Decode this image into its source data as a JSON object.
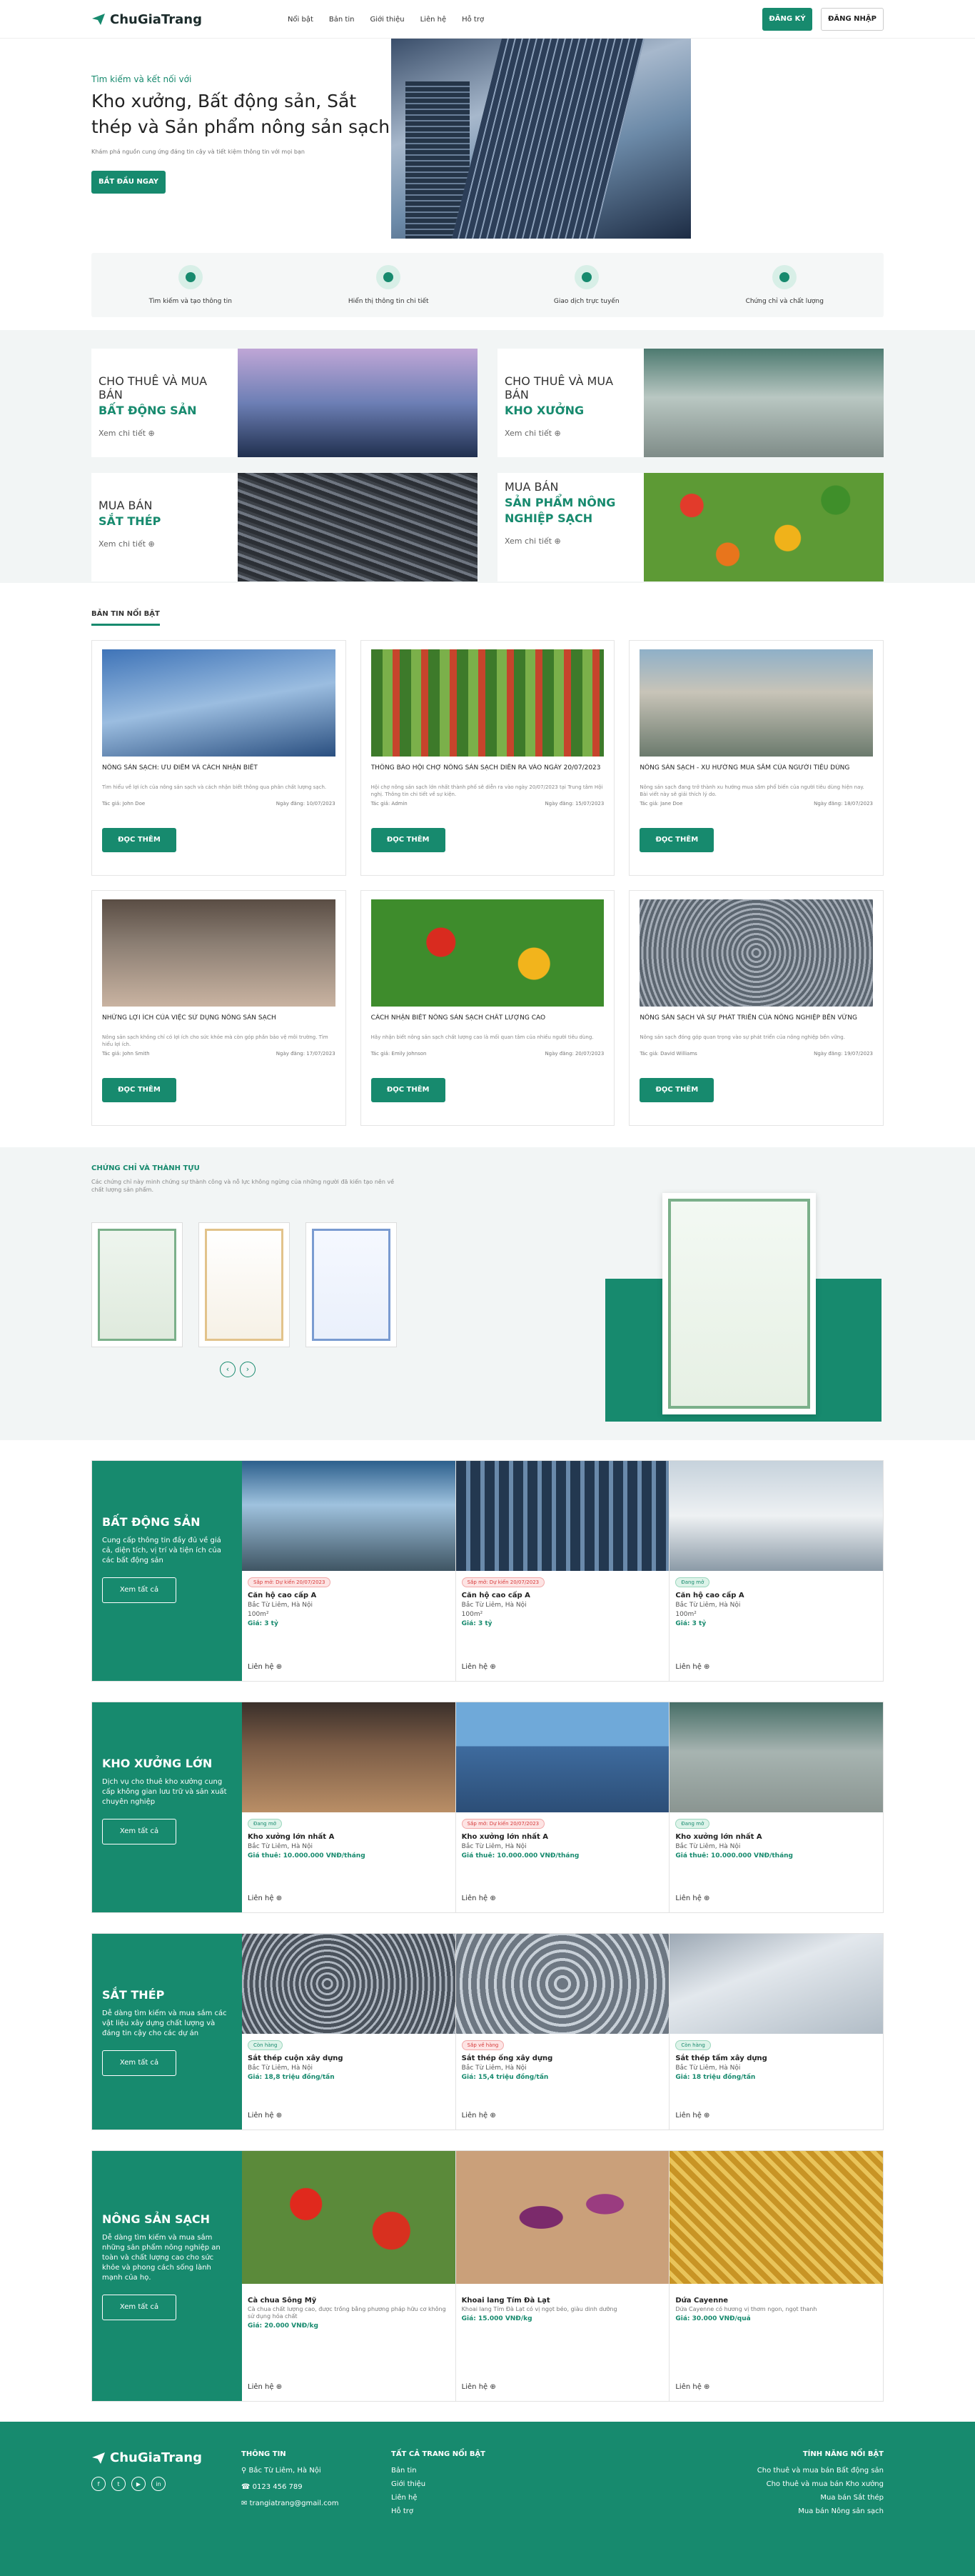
{
  "header": {
    "brand": "ChuGiaTrang",
    "nav": [
      "Nổi bật",
      "Bản tin",
      "Giới thiệu",
      "Liên hệ",
      "Hỗ trợ"
    ],
    "register": "ĐĂNG KÝ",
    "login": "ĐĂNG NHẬP"
  },
  "hero": {
    "eyebrow": "Tìm kiếm và kết nối với",
    "title": "Kho xưởng, Bất động sản, Sắt thép và Sản phẩm nông sản sạch",
    "desc": "Khám phá nguồn cung ứng đáng tin cậy và tiết kiệm thông tin với mọi bạn",
    "cta": "BẮT ĐẦU NGAY"
  },
  "features": [
    "Tìm kiếm và tạo thông tin",
    "Hiển thị thông tin chi tiết",
    "Giao dịch trực tuyến",
    "Chứng chỉ và chất lượng"
  ],
  "categories": [
    {
      "l1": "CHO THUÊ VÀ MUA BÁN",
      "l2": "BẤT ĐỘNG SẢN",
      "more": "Xem chi tiết"
    },
    {
      "l1": "CHO THUÊ VÀ MUA BÁN",
      "l2": "KHO XƯỞNG",
      "more": "Xem chi tiết"
    },
    {
      "l1": "MUA BÁN",
      "l2": "SẮT THÉP",
      "more": "Xem chi tiết"
    },
    {
      "l1": "MUA BÁN",
      "l2": "SẢN PHẨM NÔNG NGHIỆP SẠCH",
      "more": "Xem chi tiết"
    }
  ],
  "news": {
    "title": "BẢN TIN NỔI BẬT",
    "read": "ĐỌC THÊM",
    "items": [
      {
        "title": "NÔNG SẢN SẠCH: ƯU ĐIỂM VÀ CÁCH NHẬN BIẾT",
        "excerpt": "Tìm hiểu về lợi ích của nông sản sạch và cách nhận biết thông qua phân chất lượng sạch.",
        "author": "Tác giả: John Doe",
        "date": "Ngày đăng: 10/07/2023"
      },
      {
        "title": "THÔNG BÁO HỘI CHỢ NÔNG SẢN SẠCH DIỄN RA VÀO NGÀY 20/07/2023",
        "excerpt": "Hội chợ nông sản sạch lớn nhất thành phố sẽ diễn ra vào ngày 20/07/2023 tại Trung tâm Hội nghị. Thông tin chi tiết về sự kiện.",
        "author": "Tác giả: Admin",
        "date": "Ngày đăng: 15/07/2023"
      },
      {
        "title": "NÔNG SẢN SẠCH - XU HƯỚNG MUA SẮM CỦA NGƯỜI TIÊU DÙNG",
        "excerpt": "Nông sản sạch đang trở thành xu hướng mua sắm phổ biến của người tiêu dùng hiện nay. Bài viết này sẽ giải thích lý do.",
        "author": "Tác giả: Jane Doe",
        "date": "Ngày đăng: 18/07/2023"
      },
      {
        "title": "NHỮNG LỢI ÍCH CỦA VIỆC SỬ DỤNG NÔNG SẢN SẠCH",
        "excerpt": "Nông sản sạch không chỉ có lợi ích cho sức khỏe mà còn góp phần bảo vệ môi trường. Tìm hiểu lợi ích.",
        "author": "Tác giả: John Smith",
        "date": "Ngày đăng: 17/07/2023"
      },
      {
        "title": "CÁCH NHẬN BIẾT NÔNG SẢN SẠCH CHẤT LƯỢNG CAO",
        "excerpt": "Hãy nhận biết nông sản sạch chất lượng cao là mối quan tâm của nhiều người tiêu dùng.",
        "author": "Tác giả: Emily Johnson",
        "date": "Ngày đăng: 20/07/2023"
      },
      {
        "title": "NÔNG SẢN SẠCH VÀ SỰ PHÁT TRIỂN CỦA NÔNG NGHIỆP BỀN VỮNG",
        "excerpt": "Nông sản sạch đóng góp quan trọng vào sự phát triển của nông nghiệp bền vững.",
        "author": "Tác giả: David Williams",
        "date": "Ngày đăng: 19/07/2023"
      }
    ]
  },
  "certs": {
    "title": "CHỨNG CHỈ VÀ THÀNH TỰU",
    "desc": "Các chứng chỉ này minh chứng sự thành công và nỗ lực không ngừng của những người đã kiến tạo nên về chất lượng sản phẩm."
  },
  "listings": [
    {
      "title": "BẤT ĐỘNG SẢN",
      "desc": "Cung cấp thông tin đầy đủ về giá cả, diện tích, vị trí và tiện ích của các bất động sản",
      "view": "Xem tất cả",
      "items": [
        {
          "badge": "Sắp mở: Dự kiến 20/07/2023",
          "red": true,
          "name": "Căn hộ cao cấp A",
          "loc": "Bắc Từ Liêm, Hà Nội",
          "area": "100m²",
          "price": "Giá: 3 tỷ",
          "link": "Liên hệ"
        },
        {
          "badge": "Sắp mở: Dự kiến 20/07/2023",
          "red": true,
          "name": "Căn hộ cao cấp A",
          "loc": "Bắc Từ Liêm, Hà Nội",
          "area": "100m²",
          "price": "Giá: 3 tỷ",
          "link": "Liên hệ"
        },
        {
          "badge": "Đang mở",
          "red": false,
          "name": "Căn hộ cao cấp A",
          "loc": "Bắc Từ Liêm, Hà Nội",
          "area": "100m²",
          "price": "Giá: 3 tỷ",
          "link": "Liên hệ"
        }
      ]
    },
    {
      "title": "KHO XƯỞNG LỚN",
      "desc": "Dịch vụ cho thuê kho xưởng cung cấp không gian lưu trữ và sản xuất chuyên nghiệp",
      "view": "Xem tất cả",
      "items": [
        {
          "badge": "Đang mở",
          "red": false,
          "name": "Kho xưởng lớn nhất A",
          "loc": "Bắc Từ Liêm, Hà Nội",
          "area": "",
          "price": "Giá thuê: 10.000.000 VNĐ/tháng",
          "link": "Liên hệ"
        },
        {
          "badge": "Sắp mở: Dự kiến 20/07/2023",
          "red": true,
          "name": "Kho xưởng lớn nhất A",
          "loc": "Bắc Từ Liêm, Hà Nội",
          "area": "",
          "price": "Giá thuê: 10.000.000 VNĐ/tháng",
          "link": "Liên hệ"
        },
        {
          "badge": "Đang mở",
          "red": false,
          "name": "Kho xưởng lớn nhất A",
          "loc": "Bắc Từ Liêm, Hà Nội",
          "area": "",
          "price": "Giá thuê: 10.000.000 VNĐ/tháng",
          "link": "Liên hệ"
        }
      ]
    },
    {
      "title": "SẮT THÉP",
      "desc": "Dễ dàng tìm kiếm và mua sắm các vật liệu xây dựng chất lượng và đáng tin cậy cho các dự án",
      "view": "Xem tất cả",
      "items": [
        {
          "badge": "Còn hàng",
          "red": false,
          "name": "Sắt thép cuộn xây dựng",
          "loc": "Bắc Từ Liêm, Hà Nội",
          "area": "",
          "price": "Giá: 18,8 triệu đồng/tấn",
          "link": "Liên hệ"
        },
        {
          "badge": "Sắp về hàng",
          "red": true,
          "name": "Sắt thép ống xây dựng",
          "loc": "Bắc Từ Liêm, Hà Nội",
          "area": "",
          "price": "Giá: 15,4 triệu đồng/tấn",
          "link": "Liên hệ"
        },
        {
          "badge": "Còn hàng",
          "red": false,
          "name": "Sắt thép tấm xây dựng",
          "loc": "Bắc Từ Liêm, Hà Nội",
          "area": "",
          "price": "Giá: 18 triệu đồng/tấn",
          "link": "Liên hệ"
        }
      ]
    },
    {
      "title": "NÔNG SẢN SẠCH",
      "desc": "Dễ dàng tìm kiếm và mua sắm những sản phẩm nông nghiệp an toàn và chất lượng cao cho sức khỏe và phong cách sống lành mạnh của họ.",
      "view": "Xem tất cả",
      "items": [
        {
          "badge": "",
          "red": false,
          "name": "Cà chua Sông Mỹ",
          "loc": "",
          "area": "Cà chua chất lượng cao, được trồng bằng phương pháp hữu cơ không sử dụng hóa chất",
          "price": "Giá: 20.000 VNĐ/kg",
          "link": "Liên hệ"
        },
        {
          "badge": "",
          "red": false,
          "name": "Khoai lang Tím Đà Lạt",
          "loc": "",
          "area": "Khoai lang Tím Đà Lạt có vị ngọt béo, giàu dinh dưỡng",
          "price": "Giá: 15.000 VNĐ/kg",
          "link": "Liên hệ"
        },
        {
          "badge": "",
          "red": false,
          "name": "Dứa Cayenne",
          "loc": "",
          "area": "Dứa Cayenne có hương vị thơm ngon, ngọt thanh",
          "price": "Giá: 30.000 VNĐ/quả",
          "link": "Liên hệ"
        }
      ]
    }
  ],
  "footer": {
    "brand": "ChuGiaTrang",
    "info_title": "THÔNG TIN",
    "addr": "Bắc Từ Liêm, Hà Nội",
    "phone": "0123 456 789",
    "email": "trangiatrang@gmail.com",
    "pages_title": "TẤT CẢ TRANG NỔI BẬT",
    "pages": [
      "Bản tin",
      "Giới thiệu",
      "Liên hệ",
      "Hỗ trợ"
    ],
    "feat_title": "TÍNH NĂNG NỔI BẬT",
    "feats": [
      "Cho thuê và mua bán Bất động sản",
      "Cho thuê và mua bán Kho xưởng",
      "Mua bán Sắt thép",
      "Mua bán Nông sản sạch"
    ]
  },
  "colors": {
    "accent": "#178a6e"
  }
}
